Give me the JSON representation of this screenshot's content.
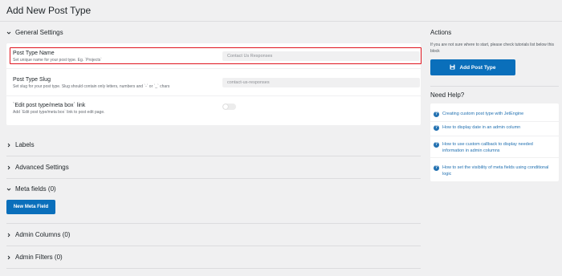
{
  "page": {
    "title": "Add New Post Type"
  },
  "general": {
    "section_label": "General Settings",
    "fields": [
      {
        "label": "Post Type Name",
        "description": "Set unique name for your post type. Eg. `Projects`",
        "value": "Contact Us Responses"
      },
      {
        "label": "Post Type Slug",
        "description": "Set slug for your post type. Slug should contain only letters, numbers and `-` or `_` chars",
        "value": "contact-us-responses"
      },
      {
        "label": "`Edit post type/meta box` link",
        "description": "Add `Edit post type/meta box` link to post edit page.",
        "toggle_on": false
      }
    ]
  },
  "sections": {
    "labels": "Labels",
    "advanced": "Advanced Settings",
    "meta_fields": "Meta fields (0)",
    "new_meta_field_button": "New Meta Field",
    "admin_columns": "Admin Columns (0)",
    "admin_filters": "Admin Filters (0)"
  },
  "actions": {
    "heading": "Actions",
    "description": "If you are not sure where to start, please check tutorials list below this block",
    "add_button": "Add Post Type"
  },
  "help": {
    "heading": "Need Help?",
    "items": [
      "Creating custom post type with JetEngine",
      "How to display date in an admin column",
      "How to use custom callback to display needed information in admin columns",
      "How to set the visibility of meta fields using conditional logic"
    ]
  },
  "colors": {
    "accent": "#0a6fbb",
    "highlight": "#e0141e",
    "link": "#2271b1"
  },
  "icons": [
    "chevron-down-icon",
    "chevron-right-icon",
    "save-icon",
    "help-icon",
    "toggle-switch"
  ]
}
